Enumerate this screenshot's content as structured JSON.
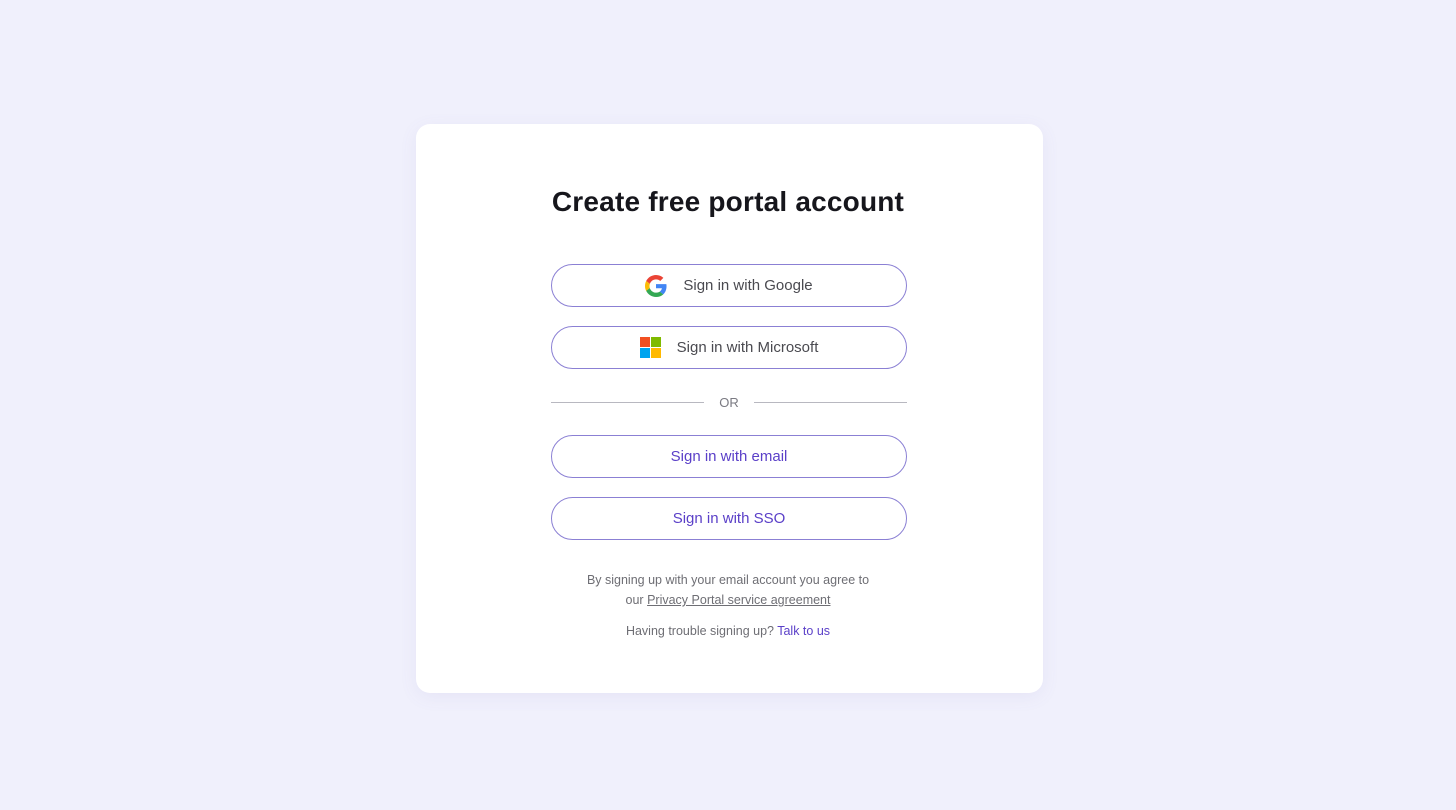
{
  "page": {
    "title": "Create free portal account"
  },
  "buttons": {
    "google_label": "Sign in with Google",
    "microsoft_label": "Sign in with Microsoft",
    "email_label": "Sign in with email",
    "sso_label": "Sign in with SSO"
  },
  "divider": {
    "text": "OR"
  },
  "legal": {
    "line1": "By signing up with your email account you agree to",
    "line2_prefix": "our",
    "link_text": "Privacy Portal service agreement"
  },
  "help": {
    "text": "Having trouble signing up?",
    "link_text": "Talk to us"
  },
  "icons": {
    "google": "google-logo-icon",
    "microsoft": "microsoft-logo-icon"
  },
  "colors": {
    "background": "#f0f0fc",
    "card": "#ffffff",
    "accent": "#5a3fc8",
    "button_border": "#8b80d4",
    "google_blue": "#4285F4",
    "google_red": "#EA4335",
    "google_yellow": "#FBBC05",
    "google_green": "#34A853",
    "ms_red": "#F25022",
    "ms_green": "#7FBA00",
    "ms_blue": "#00A4EF",
    "ms_yellow": "#FFB900"
  }
}
